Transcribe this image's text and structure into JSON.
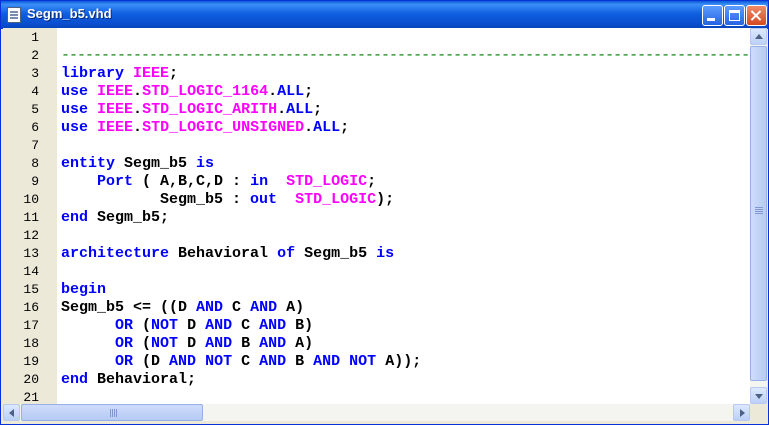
{
  "window": {
    "title": "Segm_b5.vhd",
    "icon": "document-icon"
  },
  "editor": {
    "line_numbers": [
      "1",
      "2",
      "3",
      "4",
      "5",
      "6",
      "7",
      "8",
      "9",
      "10",
      "11",
      "12",
      "13",
      "14",
      "15",
      "16",
      "17",
      "18",
      "19",
      "20",
      "21"
    ],
    "lines": [
      [],
      [
        {
          "t": "----------------------------------------------------------------------------------------",
          "c": "dash"
        }
      ],
      [
        {
          "t": "library",
          "c": "kw"
        },
        {
          "t": " "
        },
        {
          "t": "IEEE",
          "c": "ty"
        },
        {
          "t": ";"
        }
      ],
      [
        {
          "t": "use",
          "c": "kw"
        },
        {
          "t": " "
        },
        {
          "t": "IEEE",
          "c": "ty"
        },
        {
          "t": "."
        },
        {
          "t": "STD_LOGIC_1164",
          "c": "ty"
        },
        {
          "t": "."
        },
        {
          "t": "ALL",
          "c": "kw"
        },
        {
          "t": ";"
        }
      ],
      [
        {
          "t": "use",
          "c": "kw"
        },
        {
          "t": " "
        },
        {
          "t": "IEEE",
          "c": "ty"
        },
        {
          "t": "."
        },
        {
          "t": "STD_LOGIC_ARITH",
          "c": "ty"
        },
        {
          "t": "."
        },
        {
          "t": "ALL",
          "c": "kw"
        },
        {
          "t": ";"
        }
      ],
      [
        {
          "t": "use",
          "c": "kw"
        },
        {
          "t": " "
        },
        {
          "t": "IEEE",
          "c": "ty"
        },
        {
          "t": "."
        },
        {
          "t": "STD_LOGIC_UNSIGNED",
          "c": "ty"
        },
        {
          "t": "."
        },
        {
          "t": "ALL",
          "c": "kw"
        },
        {
          "t": ";"
        }
      ],
      [],
      [
        {
          "t": "entity",
          "c": "kw"
        },
        {
          "t": " Segm_b5 "
        },
        {
          "t": "is",
          "c": "kw"
        }
      ],
      [
        {
          "t": "    "
        },
        {
          "t": "Port",
          "c": "kw"
        },
        {
          "t": " ( A,B,C,D : "
        },
        {
          "t": "in",
          "c": "kw"
        },
        {
          "t": "  "
        },
        {
          "t": "STD_LOGIC",
          "c": "ty"
        },
        {
          "t": ";"
        }
      ],
      [
        {
          "t": "           Segm_b5 : "
        },
        {
          "t": "out",
          "c": "kw"
        },
        {
          "t": "  "
        },
        {
          "t": "STD_LOGIC",
          "c": "ty"
        },
        {
          "t": ");"
        }
      ],
      [
        {
          "t": "end",
          "c": "kw"
        },
        {
          "t": " Segm_b5;"
        }
      ],
      [],
      [
        {
          "t": "architecture",
          "c": "kw"
        },
        {
          "t": " Behavioral "
        },
        {
          "t": "of",
          "c": "kw"
        },
        {
          "t": " Segm_b5 "
        },
        {
          "t": "is",
          "c": "kw"
        }
      ],
      [],
      [
        {
          "t": "begin",
          "c": "kw"
        }
      ],
      [
        {
          "t": "Segm_b5 <= ((D "
        },
        {
          "t": "AND",
          "c": "kw"
        },
        {
          "t": " C "
        },
        {
          "t": "AND",
          "c": "kw"
        },
        {
          "t": " A)"
        }
      ],
      [
        {
          "t": "      "
        },
        {
          "t": "OR",
          "c": "kw"
        },
        {
          "t": " ("
        },
        {
          "t": "NOT",
          "c": "kw"
        },
        {
          "t": " D "
        },
        {
          "t": "AND",
          "c": "kw"
        },
        {
          "t": " C "
        },
        {
          "t": "AND",
          "c": "kw"
        },
        {
          "t": " B)"
        }
      ],
      [
        {
          "t": "      "
        },
        {
          "t": "OR",
          "c": "kw"
        },
        {
          "t": " ("
        },
        {
          "t": "NOT",
          "c": "kw"
        },
        {
          "t": " D "
        },
        {
          "t": "AND",
          "c": "kw"
        },
        {
          "t": " B "
        },
        {
          "t": "AND",
          "c": "kw"
        },
        {
          "t": " A)"
        }
      ],
      [
        {
          "t": "      "
        },
        {
          "t": "OR",
          "c": "kw"
        },
        {
          "t": " (D "
        },
        {
          "t": "AND",
          "c": "kw"
        },
        {
          "t": " "
        },
        {
          "t": "NOT",
          "c": "kw"
        },
        {
          "t": " C "
        },
        {
          "t": "AND",
          "c": "kw"
        },
        {
          "t": " B "
        },
        {
          "t": "AND",
          "c": "kw"
        },
        {
          "t": " "
        },
        {
          "t": "NOT",
          "c": "kw"
        },
        {
          "t": " A));"
        }
      ],
      [
        {
          "t": "end",
          "c": "kw"
        },
        {
          "t": " Behavioral;"
        }
      ],
      []
    ]
  },
  "colors": {
    "keyword": "#0000ff",
    "type": "#ff00ff",
    "comment": "#008000",
    "titlebar": "#0a5ad8"
  },
  "icons": [
    "document-icon",
    "minimize-icon",
    "maximize-icon",
    "close-icon",
    "scroll-up-icon",
    "scroll-down-icon",
    "scroll-left-icon",
    "scroll-right-icon"
  ]
}
